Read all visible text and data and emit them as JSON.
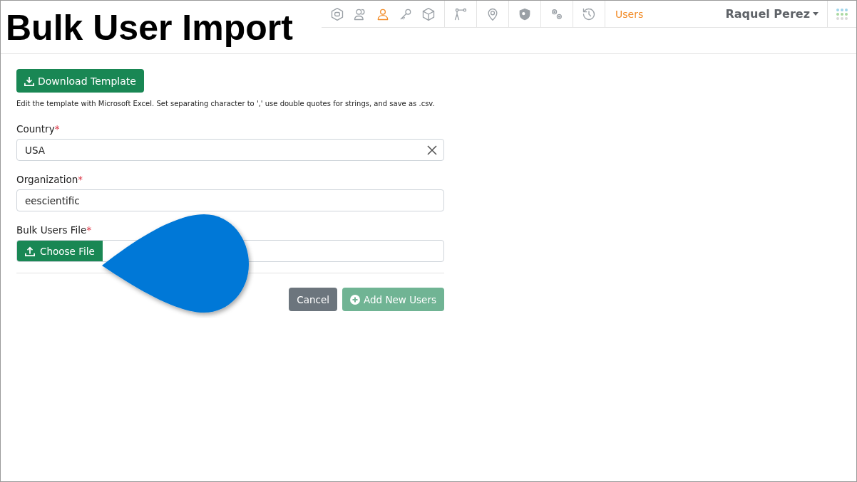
{
  "overlay_title": "Bulk User Import",
  "nav": {
    "icon_groups": [
      [
        {
          "kind": "badge",
          "selected": false
        },
        {
          "kind": "users",
          "selected": false
        },
        {
          "kind": "user",
          "selected": true
        },
        {
          "kind": "key",
          "selected": false
        },
        {
          "kind": "cube",
          "selected": false
        }
      ],
      [
        {
          "kind": "route",
          "selected": false
        }
      ],
      [
        {
          "kind": "pin",
          "selected": false
        }
      ],
      [
        {
          "kind": "shield",
          "selected": false
        }
      ],
      [
        {
          "kind": "gears",
          "selected": false
        }
      ],
      [
        {
          "kind": "history",
          "selected": false
        }
      ]
    ],
    "current_page": "Users",
    "user_name": "Raquel Perez"
  },
  "download_button": "Download Template",
  "help_text": "Edit the template with Microsoft Excel. Set separating character to ',' use double quotes for strings, and save as .csv.",
  "fields": [
    {
      "kind": "select",
      "label": "Country",
      "required_mark": "*",
      "value": "USA",
      "clearable": true
    },
    {
      "kind": "text",
      "label": "Organization",
      "required_mark": "*",
      "value": "eescientific"
    },
    {
      "kind": "file",
      "label": "Bulk Users File",
      "required_mark": "*",
      "button": "Choose File"
    }
  ],
  "actions": [
    {
      "kind": "cancel",
      "label": "Cancel",
      "disabled": false
    },
    {
      "kind": "add",
      "label": "Add New Users",
      "disabled": true
    }
  ]
}
